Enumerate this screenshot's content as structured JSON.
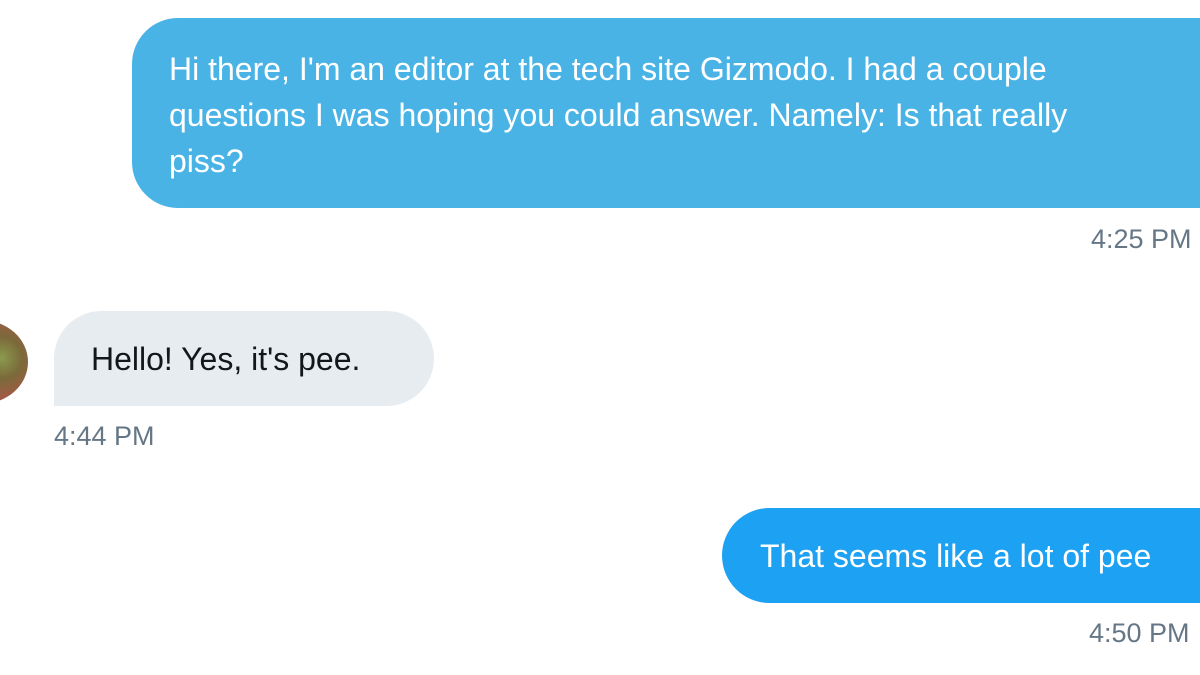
{
  "messages": [
    {
      "direction": "outgoing",
      "lines": [
        "Hi there, I'm an editor at the tech site Gizmodo. I had a couple",
        "questions I was hoping you could answer. Namely: Is that really",
        "piss?"
      ],
      "time": "4:25 PM"
    },
    {
      "direction": "incoming",
      "lines": [
        "Hello! Yes, it's pee."
      ],
      "time": "4:44 PM"
    },
    {
      "direction": "outgoing",
      "lines": [
        "That seems like a lot of pee"
      ],
      "time": "4:50 PM"
    }
  ],
  "colors": {
    "outgoing_bubble_first": "#4ab3e6",
    "outgoing_bubble": "#1da1f2",
    "incoming_bubble": "#e6ecf0",
    "incoming_text": "#14171a",
    "timestamp_text": "#657786"
  },
  "contact": {
    "avatar_icon": "user-avatar-photo"
  }
}
